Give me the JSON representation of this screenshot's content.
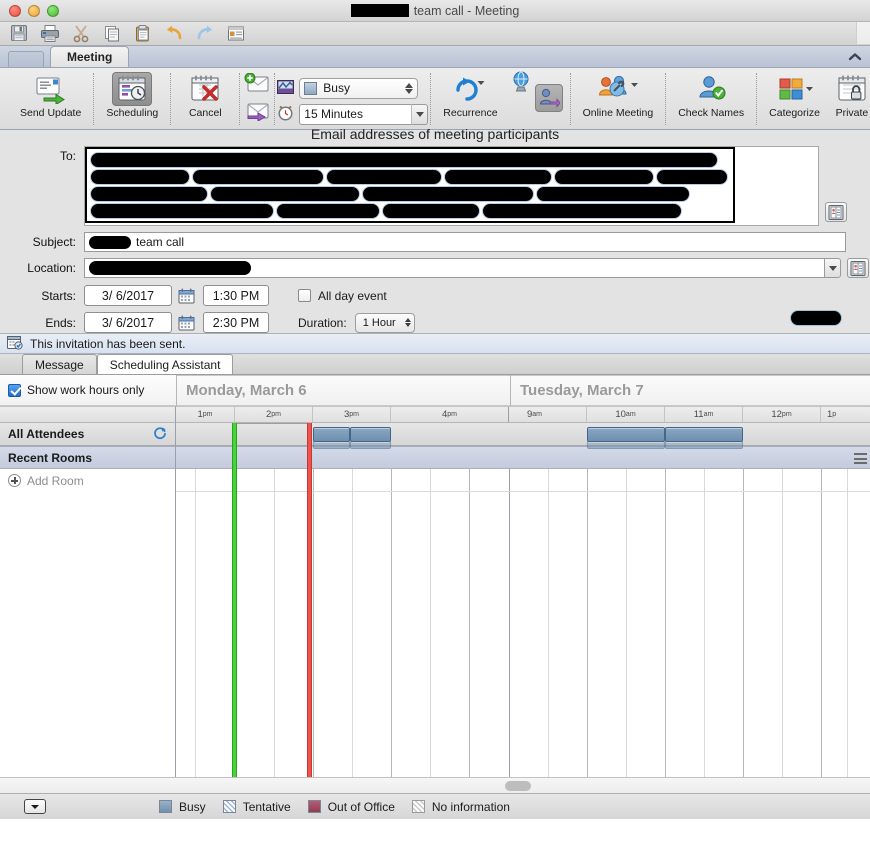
{
  "window": {
    "title_redacted": true,
    "title_suffix": "team call - Meeting",
    "traffic_lights": [
      "close",
      "minimize",
      "zoom"
    ]
  },
  "quick_access": [
    {
      "name": "save-icon",
      "label": "Save"
    },
    {
      "name": "print-icon",
      "label": "Print"
    },
    {
      "name": "cut-icon",
      "label": "Cut"
    },
    {
      "name": "copy-icon",
      "label": "Copy"
    },
    {
      "name": "paste-icon",
      "label": "Paste"
    },
    {
      "name": "undo-icon",
      "label": "Undo"
    },
    {
      "name": "redo-icon",
      "label": "Redo"
    },
    {
      "name": "format-icon",
      "label": "Formatting"
    }
  ],
  "ribbon": {
    "tab_label": "Meeting",
    "collapse_label": "Collapse Ribbon",
    "buttons": [
      {
        "name": "send-update-button",
        "label": "Send Update"
      },
      {
        "name": "scheduling-button",
        "label": "Scheduling",
        "pressed": true
      },
      {
        "name": "cancel-button",
        "label": "Cancel"
      },
      {
        "name": "recurrence-button",
        "label": "Recurrence"
      },
      {
        "name": "online-meeting-button",
        "label": "Online Meeting"
      },
      {
        "name": "check-names-button",
        "label": "Check Names"
      },
      {
        "name": "categorize-button",
        "label": "Categorize"
      },
      {
        "name": "private-button",
        "label": "Private"
      }
    ],
    "forward_invite_label": "Forward",
    "new_invite_label": "New Invite",
    "show_as_value": "Busy",
    "reminder_value": "15 Minutes"
  },
  "form": {
    "hint_text": "Email addresses of meeting participants",
    "to_label": "To:",
    "to_recipients_redacted": 4,
    "subject_label": "Subject:",
    "subject_value": "team call",
    "subject_redacted_prefix": true,
    "location_label": "Location:",
    "location_value": "",
    "location_redacted": true,
    "starts_label": "Starts:",
    "starts_date": "3/  6/2017",
    "starts_time": "1:30 PM",
    "ends_label": "Ends:",
    "ends_date": "3/  6/2017",
    "ends_time": "2:30 PM",
    "all_day_label": "All day event",
    "all_day_checked": false,
    "duration_label": "Duration:",
    "duration_value": "1 Hour",
    "address_book_label": "Address Book"
  },
  "info_bar": {
    "text": "This invitation has been sent.",
    "icon": "invitation-icon"
  },
  "page_tabs": [
    {
      "name": "tab-message",
      "label": "Message",
      "active": false
    },
    {
      "name": "tab-scheduling-assistant",
      "label": "Scheduling Assistant",
      "active": true
    }
  ],
  "scheduling": {
    "show_work_hours_label": "Show work hours only",
    "show_work_hours_checked": true,
    "refresh_label": "Refresh",
    "rows": [
      {
        "name": "all-attendees-row",
        "label": "All Attendees",
        "type": "header"
      },
      {
        "name": "recent-rooms-row",
        "label": "Recent Rooms",
        "type": "group"
      },
      {
        "name": "add-room-row",
        "label": "Add Room",
        "type": "add"
      }
    ],
    "days": [
      {
        "name": "day-monday",
        "label": "Monday, March 6",
        "hours": [
          "1",
          "2",
          "3",
          "4"
        ],
        "meridiems": [
          "pm",
          "pm",
          "pm",
          "pm"
        ]
      },
      {
        "name": "day-tuesday",
        "label": "Tuesday, March 7",
        "hours": [
          "9",
          "10",
          "11",
          "12",
          "1"
        ],
        "meridiems": [
          "am",
          "am",
          "am",
          "pm",
          "p"
        ]
      }
    ],
    "selection": {
      "start_time": "1:30 PM",
      "end_time": "2:30 PM"
    },
    "busy_blocks": [
      {
        "day": "monday",
        "start_hour": 2.5,
        "end_hour": 3.0
      },
      {
        "day": "monday",
        "start_hour": 3.0,
        "end_hour": 3.5
      },
      {
        "day": "tuesday",
        "start_hour": 10.0,
        "end_hour": 11.0
      },
      {
        "day": "tuesday",
        "start_hour": 11.0,
        "end_hour": 12.0
      }
    ]
  },
  "legend": {
    "expand_label": "Options",
    "items": [
      {
        "name": "legend-busy",
        "label": "Busy",
        "color": "#7d9ab5"
      },
      {
        "name": "legend-tentative",
        "label": "Tentative",
        "color": "#c7d8ee"
      },
      {
        "name": "legend-out-of-office",
        "label": "Out of Office",
        "color": "#9e4a63"
      },
      {
        "name": "legend-no-information",
        "label": "No information",
        "color": "#e8e8e8"
      }
    ]
  }
}
